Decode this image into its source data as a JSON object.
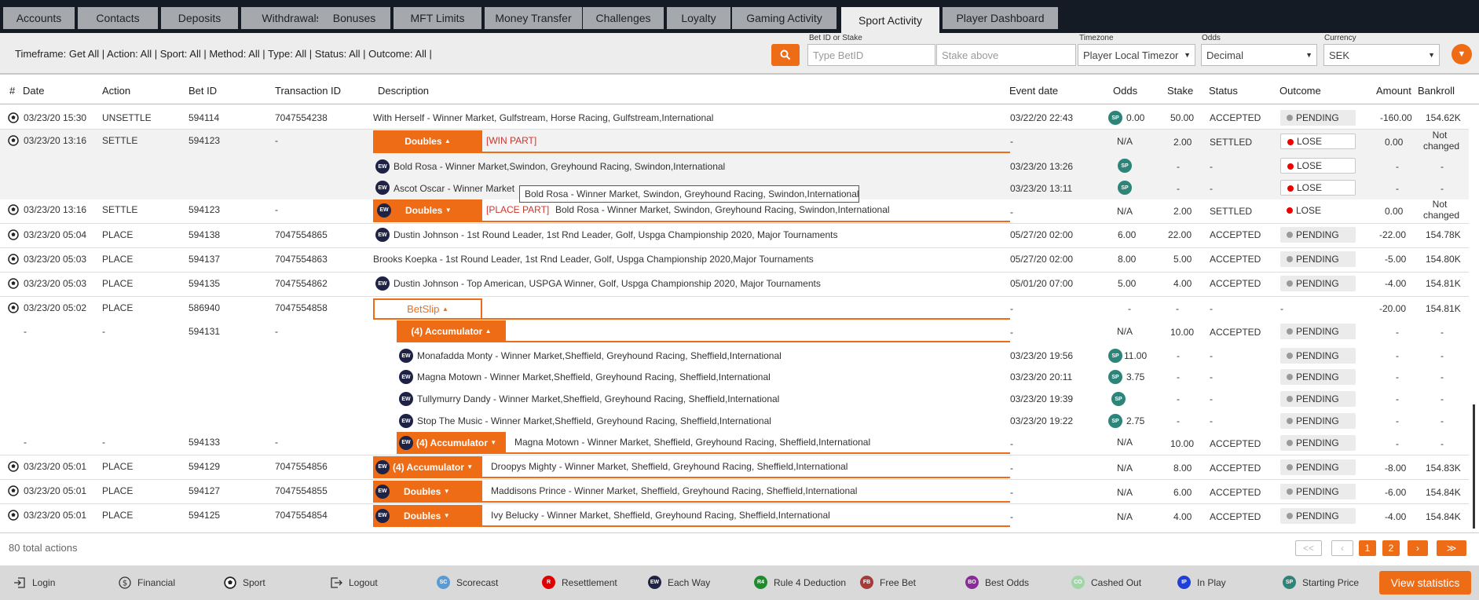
{
  "tabs": [
    "Accounts",
    "Contacts",
    "Deposits",
    "Withdrawals",
    "Bonuses",
    "MFT Limits",
    "Money Transfer",
    "Challenges",
    "Loyalty",
    "Gaming Activity",
    "Sport Activity",
    "Player Dashboard"
  ],
  "active_tab": "Sport Activity",
  "filters": {
    "summary": "Timeframe: Get All | Action: All | Sport: All | Method: All | Type: All | Status: All | Outcome: All |",
    "betid_label": "Bet ID or Stake",
    "betid_placeholder": "Type BetID",
    "stake_placeholder": "Stake above",
    "timezone_label": "Timezone",
    "timezone_value": "Player Local Timezor",
    "odds_label": "Odds",
    "odds_value": "Decimal",
    "currency_label": "Currency",
    "currency_value": "SEK"
  },
  "columns": [
    "#",
    "Date",
    "Action",
    "Bet ID",
    "Transaction ID",
    "Description",
    "Event date",
    "Odds",
    "Stake",
    "Status",
    "Outcome",
    "Amount",
    "Bankroll"
  ],
  "rows": [
    {
      "date": "03/23/20 15:30",
      "action": "UNSETTLE",
      "bet_id": "594114",
      "txn_id": "7047554238",
      "desc": "With Herself - Winner Market, Gulfstream, Horse Racing, Gulfstream,International",
      "event_date": "03/22/20 22:43",
      "odds": "0.00",
      "stake": "50.00",
      "status": "ACCEPTED",
      "outcome": "PENDING",
      "amount": "-160.00",
      "bankroll": "154.62K"
    },
    {
      "date": "03/23/20 13:16",
      "action": "SETTLE",
      "bet_id": "594123",
      "txn_id": "-",
      "bet_type": "Doubles",
      "part": "[WIN PART]",
      "event_date": "-",
      "odds": "N/A",
      "stake": "2.00",
      "status": "SETTLED",
      "outcome": "LOSE",
      "amount": "0.00",
      "bankroll": "Not changed"
    },
    {
      "desc": "Bold Rosa - Winner Market,Swindon, Greyhound Racing, Swindon,International",
      "event_date": "03/23/20 13:26",
      "stake": "-",
      "status": "-",
      "outcome": "LOSE",
      "amount": "-",
      "bankroll": "-"
    },
    {
      "desc": "Ascot Oscar - Winner Market",
      "event_date": "03/23/20 13:11",
      "stake": "-",
      "status": "-",
      "outcome": "LOSE",
      "amount": "-",
      "bankroll": "-"
    },
    {
      "date": "03/23/20 13:16",
      "action": "SETTLE",
      "bet_id": "594123",
      "txn_id": "-",
      "bet_type": "Doubles",
      "part": "[PLACE PART]",
      "desc": "Bold Rosa - Winner Market,  Swindon, Greyhound Racing, Swindon,International",
      "event_date": "-",
      "odds": "N/A",
      "stake": "2.00",
      "status": "SETTLED",
      "outcome": "LOSE",
      "amount": "0.00",
      "bankroll": "Not changed"
    },
    {
      "date": "03/23/20 05:04",
      "action": "PLACE",
      "bet_id": "594138",
      "txn_id": "7047554865",
      "desc": "Dustin Johnson - 1st Round Leader, 1st Rnd Leader, Golf, Uspga Championship 2020, Major Tournaments",
      "event_date": "05/27/20 02:00",
      "odds": "6.00",
      "stake": "22.00",
      "status": "ACCEPTED",
      "outcome": "PENDING",
      "amount": "-22.00",
      "bankroll": "154.78K"
    },
    {
      "date": "03/23/20 05:03",
      "action": "PLACE",
      "bet_id": "594137",
      "txn_id": "7047554863",
      "desc": "Brooks Koepka - 1st Round Leader, 1st Rnd Leader, Golf, Uspga Championship 2020,Major Tournaments",
      "event_date": "05/27/20 02:00",
      "odds": "8.00",
      "stake": "5.00",
      "status": "ACCEPTED",
      "outcome": "PENDING",
      "amount": "-5.00",
      "bankroll": "154.80K"
    },
    {
      "date": "03/23/20 05:03",
      "action": "PLACE",
      "bet_id": "594135",
      "txn_id": "7047554862",
      "desc": "Dustin Johnson - Top American, USPGA Winner, Golf, Uspga Championship 2020, Major Tournaments",
      "event_date": "05/01/20 07:00",
      "odds": "5.00",
      "stake": "4.00",
      "status": "ACCEPTED",
      "outcome": "PENDING",
      "amount": "-4.00",
      "bankroll": "154.81K"
    },
    {
      "date": "03/23/20 05:02",
      "action": "PLACE",
      "bet_id": "586940",
      "txn_id": "7047554858",
      "bet_type": "BetSlip",
      "event_date": "-",
      "odds": "-",
      "stake": "-",
      "status": "-",
      "outcome": "-",
      "amount": "-20.00",
      "bankroll": "154.81K"
    },
    {
      "date": "-",
      "action": "-",
      "bet_id": "594131",
      "txn_id": "-",
      "bet_type": "(4) Accumulator",
      "event_date": "-",
      "odds": "N/A",
      "stake": "10.00",
      "status": "ACCEPTED",
      "outcome": "PENDING",
      "amount": "-",
      "bankroll": "-"
    },
    {
      "desc": "Monafadda Monty - Winner Market,Sheffield, Greyhound Racing, Sheffield,International",
      "event_date": "03/23/20 19:56",
      "odds": "11.00",
      "stake": "-",
      "status": "-",
      "outcome": "PENDING",
      "amount": "-",
      "bankroll": "-"
    },
    {
      "desc": "Magna Motown - Winner Market,Sheffield, Greyhound Racing, Sheffield,International",
      "event_date": "03/23/20 20:11",
      "odds": "3.75",
      "stake": "-",
      "status": "-",
      "outcome": "PENDING",
      "amount": "-",
      "bankroll": "-"
    },
    {
      "desc": "Tullymurry Dandy - Winner Market,Sheffield, Greyhound Racing, Sheffield,International",
      "event_date": "03/23/20 19:39",
      "stake": "-",
      "status": "-",
      "outcome": "PENDING",
      "amount": "-",
      "bankroll": "-"
    },
    {
      "desc": "Stop The Music - Winner Market,Sheffield, Greyhound Racing, Sheffield,International",
      "event_date": "03/23/20 19:22",
      "odds": "2.75",
      "stake": "-",
      "status": "-",
      "outcome": "PENDING",
      "amount": "-",
      "bankroll": "-"
    },
    {
      "date": "-",
      "action": "-",
      "bet_id": "594133",
      "txn_id": "-",
      "bet_type": "(4) Accumulator",
      "desc": "Magna Motown - Winner Market,  Sheffield, Greyhound Racing, Sheffield,International",
      "event_date": "-",
      "odds": "N/A",
      "stake": "10.00",
      "status": "ACCEPTED",
      "outcome": "PENDING",
      "amount": "-",
      "bankroll": "-"
    },
    {
      "date": "03/23/20 05:01",
      "action": "PLACE",
      "bet_id": "594129",
      "txn_id": "7047554856",
      "bet_type": "(4) Accumulator",
      "desc": "Droopys Mighty - Winner Market,  Sheffield, Greyhound Racing, Sheffield,International",
      "event_date": "-",
      "odds": "N/A",
      "stake": "8.00",
      "status": "ACCEPTED",
      "outcome": "PENDING",
      "amount": "-8.00",
      "bankroll": "154.83K"
    },
    {
      "date": "03/23/20 05:01",
      "action": "PLACE",
      "bet_id": "594127",
      "txn_id": "7047554855",
      "bet_type": "Doubles",
      "desc": "Maddisons Prince - Winner Market,  Sheffield, Greyhound Racing, Sheffield,International",
      "event_date": "-",
      "odds": "N/A",
      "stake": "6.00",
      "status": "ACCEPTED",
      "outcome": "PENDING",
      "amount": "-6.00",
      "bankroll": "154.84K"
    },
    {
      "date": "03/23/20 05:01",
      "action": "PLACE",
      "bet_id": "594125",
      "txn_id": "7047554854",
      "bet_type": "Doubles",
      "desc": "Ivy Belucky - Winner Market,  Sheffield, Greyhound Racing, Sheffield,International",
      "event_date": "-",
      "odds": "N/A",
      "stake": "4.00",
      "status": "ACCEPTED",
      "outcome": "PENDING",
      "amount": "-4.00",
      "bankroll": "154.84K"
    }
  ],
  "tooltip": "Bold Rosa - Winner Market, Swindon, Greyhound Racing, Swindon,International",
  "badges": {
    "ew": "EW",
    "sp": "SP"
  },
  "footer": {
    "total": "80 total actions",
    "pages": [
      "1",
      "2"
    ],
    "first": "<<",
    "prev": "‹",
    "next": "›",
    "last": "≫"
  },
  "legend": [
    {
      "label": "Login",
      "icon": "login-icon"
    },
    {
      "label": "Financial",
      "icon": "dollar-icon"
    },
    {
      "label": "Sport",
      "icon": "soccer-ball-icon"
    },
    {
      "label": "Logout",
      "icon": "logout-icon"
    },
    {
      "label": "Scorecast",
      "abbr": "SC",
      "color": "#5a9bd5"
    },
    {
      "label": "Resettlement",
      "abbr": "R",
      "color": "#e00000"
    },
    {
      "label": "Each Way",
      "abbr": "EW",
      "color": "#1e2346"
    },
    {
      "label": "Rule 4 Deduction",
      "abbr": "R4",
      "color": "#1f8b2e"
    },
    {
      "label": "Free Bet",
      "abbr": "FB",
      "color": "#a83a3a"
    },
    {
      "label": "Best Odds",
      "abbr": "BO",
      "color": "#8a2b9a"
    },
    {
      "label": "Cashed Out",
      "abbr": "CO",
      "color": "#9ed6a8"
    },
    {
      "label": "In Play",
      "abbr": "IP",
      "color": "#1f3fd8"
    },
    {
      "label": "Starting Price",
      "abbr": "SP",
      "color": "#2d8478"
    }
  ],
  "view_statistics": "View statistics",
  "colors": {
    "accent": "#ef6c16",
    "tabbar": "#141b24"
  }
}
